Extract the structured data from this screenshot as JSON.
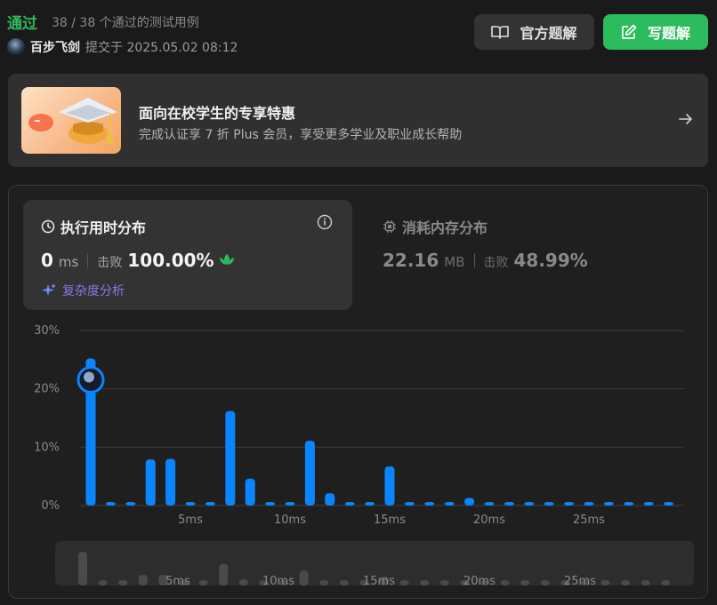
{
  "header": {
    "status": "通过",
    "cases": "38 / 38 个通过的测试用例",
    "username": "百步飞剑",
    "submitted": "提交于 2025.05.02 08:12",
    "official_solution_label": "官方题解",
    "write_solution_label": "写题解",
    "accent_green": "#2cbb5d"
  },
  "promo": {
    "title": "面向在校学生的专享特惠",
    "subtitle": "完成认证享 7 折 Plus 会员，享受更多学业及职业成长帮助",
    "icon": "graduation-cap-icon"
  },
  "runtime": {
    "title": "执行用时分布",
    "value": "0",
    "unit": "ms",
    "beat_label": "击败",
    "beat_value": "100.00%",
    "analysis_label": "复杂度分析"
  },
  "memory": {
    "title": "消耗内存分布",
    "value": "22.16",
    "unit": "MB",
    "beat_label": "击败",
    "beat_value": "48.99%"
  },
  "chart_data": {
    "type": "bar",
    "ylabel_ticks": [
      "0%",
      "10%",
      "20%",
      "30%"
    ],
    "ylim": [
      0,
      30
    ],
    "x_ticks": [
      "5ms",
      "10ms",
      "15ms",
      "20ms",
      "25ms"
    ],
    "x": [
      0,
      1,
      2,
      3,
      4,
      5,
      6,
      7,
      8,
      9,
      10,
      11,
      12,
      13,
      14,
      15,
      16,
      17,
      18,
      19,
      20,
      21,
      22,
      23,
      24,
      25,
      26,
      27,
      28,
      29
    ],
    "values": [
      25.2,
      0.6,
      0.6,
      7.9,
      8.0,
      0.6,
      0.6,
      16.2,
      4.6,
      0.6,
      0.6,
      11.1,
      2.1,
      0.6,
      0.6,
      6.7,
      0.6,
      0.6,
      0.6,
      1.3,
      0.6,
      0.6,
      0.6,
      0.6,
      0.6,
      0.6,
      0.6,
      0.6,
      0.6,
      0.6
    ],
    "highlight_index": 0,
    "bar_color": "#0a84ff",
    "grid": true
  }
}
